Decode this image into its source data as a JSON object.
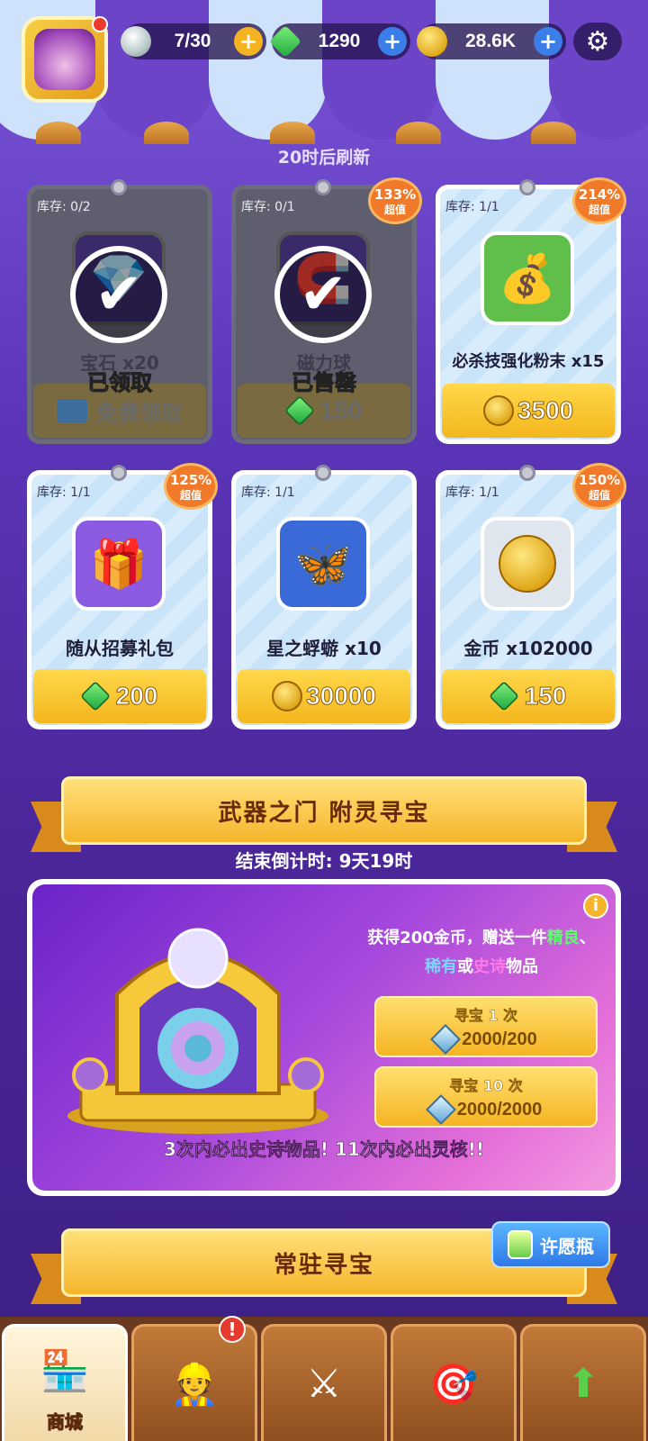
{
  "topbar": {
    "stamina": "7/30",
    "gems": "1290",
    "coins": "28.6K",
    "plus": "+",
    "settings_icon": "gear-icon"
  },
  "shop": {
    "refresh_text": "20时后刷新",
    "items": [
      {
        "stock": "库存: 0/2",
        "name": "宝石 x20",
        "status": "已领取",
        "price": "免费领取",
        "icon": "gem-icon"
      },
      {
        "stock": "库存: 0/1",
        "name": "磁力球",
        "status": "已售罄",
        "price": "150",
        "badge_pct": "133%",
        "badge_sub": "超值",
        "icon": "magnet-ball-icon"
      },
      {
        "stock": "库存: 1/1",
        "name": "必杀技强化粉末 x15",
        "price": "3500",
        "badge_pct": "214%",
        "badge_sub": "超值",
        "icon": "powder-bag-icon"
      },
      {
        "stock": "库存: 1/1",
        "name": "随从招募礼包",
        "price": "200",
        "badge_pct": "125%",
        "badge_sub": "超值",
        "icon": "mystery-box-icon"
      },
      {
        "stock": "库存: 1/1",
        "name": "星之蜉蝣 x10",
        "price": "30000",
        "icon": "star-mayfly-icon"
      },
      {
        "stock": "库存: 1/1",
        "name": "金币 x102000",
        "price": "150",
        "badge_pct": "150%",
        "badge_sub": "超值",
        "icon": "coin-icon"
      }
    ]
  },
  "event": {
    "title": "武器之门  附灵寻宝",
    "countdown": "结束倒计时: 9天19时",
    "desc_a": "获得200金币，赠送一件",
    "desc_b": "精良",
    "desc_c": "、",
    "desc_d": "稀有",
    "desc_e": "或",
    "desc_f": "史诗",
    "desc_g": "物品",
    "btn1_label": "寻宝 1 次",
    "btn1_cost": "2000/200",
    "btn10_label": "寻宝 10 次",
    "btn10_cost": "2000/2000",
    "guar_a": "3次内必出",
    "guar_b": "史诗",
    "guar_c": "物品!  11次内必出",
    "guar_d": "灵核",
    "guar_e": "!!",
    "info": "i"
  },
  "regular": {
    "title": "常驻寻宝",
    "wish_label": "许愿瓶"
  },
  "nav": {
    "shop_label": "商城",
    "alert": "!"
  },
  "colors": {
    "accent": "#f6b52b",
    "purple": "#5b35b8",
    "epic": "#ff7ae8"
  }
}
